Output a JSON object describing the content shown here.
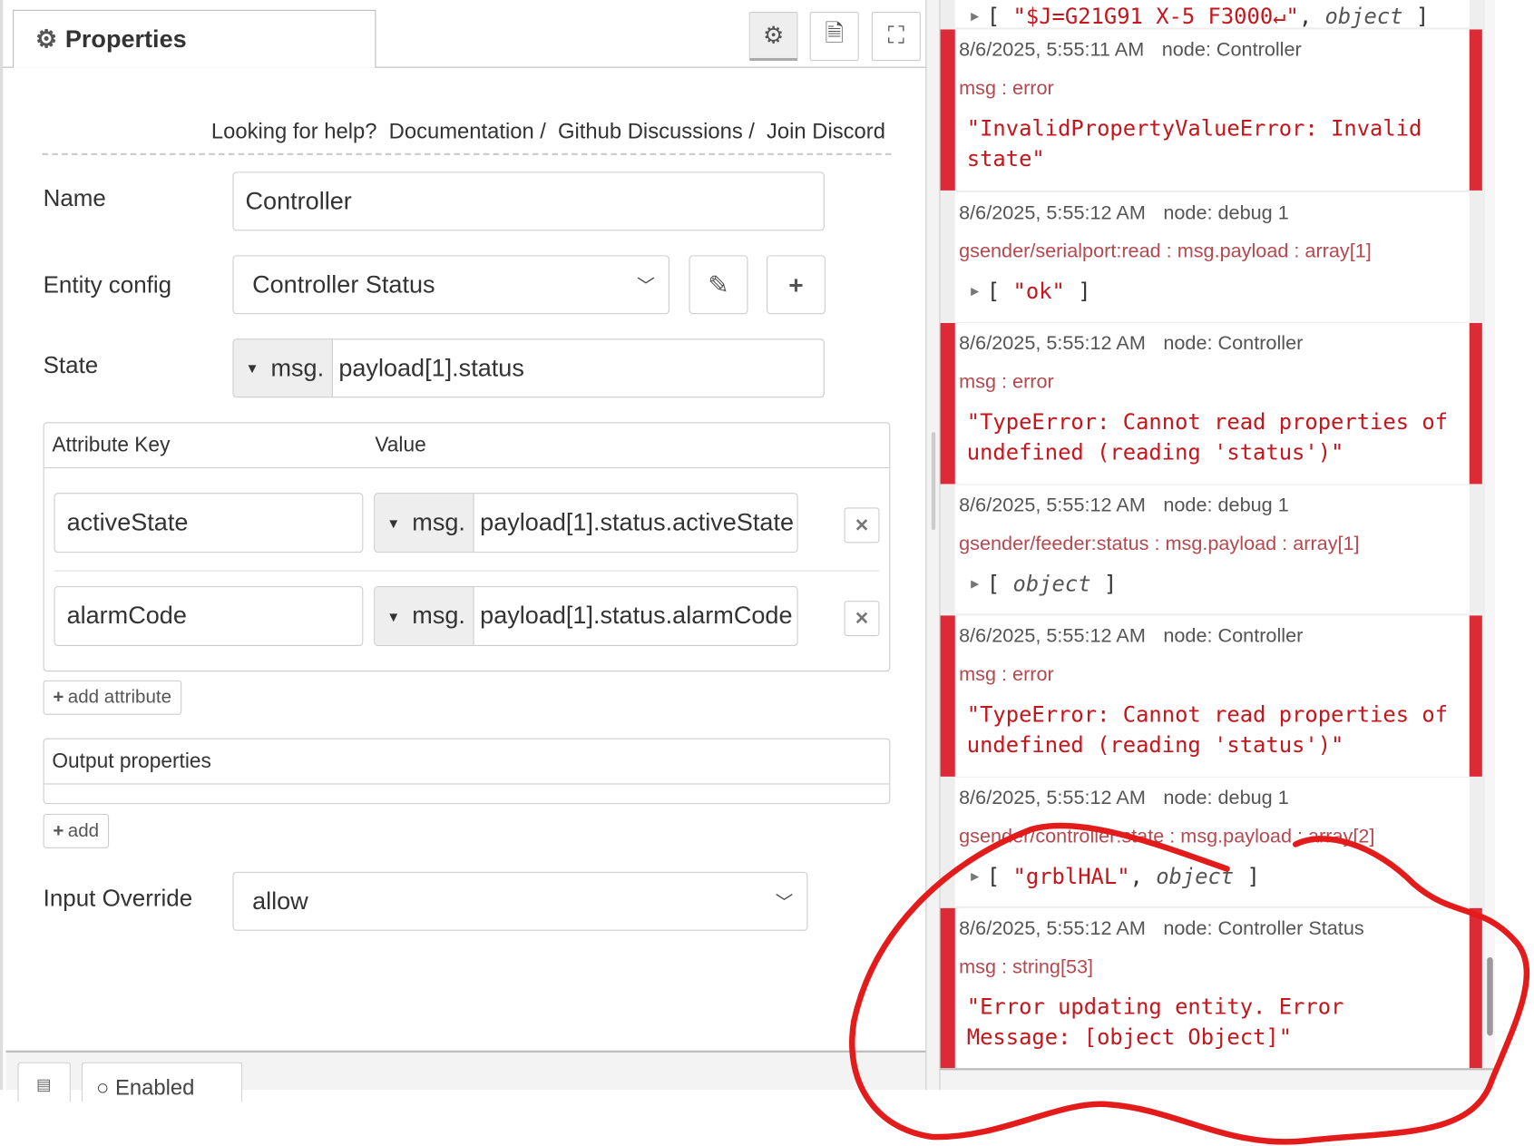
{
  "tab": {
    "label": "Properties"
  },
  "toolbar": {
    "icons": [
      "gear-icon",
      "document-icon",
      "frame-icon"
    ]
  },
  "help": {
    "prefix": "Looking for help?",
    "links": [
      "Documentation",
      "Github Discussions",
      "Join Discord"
    ],
    "sep": "/"
  },
  "form": {
    "name_label": "Name",
    "name_value": "Controller",
    "entity_label": "Entity config",
    "entity_value": "Controller Status",
    "state_label": "State",
    "state_prefix": "msg.",
    "state_value": "payload[1].status",
    "attr_header_key": "Attribute Key",
    "attr_header_value": "Value",
    "attributes": [
      {
        "key": "activeState",
        "prefix": "msg.",
        "value": "payload[1].status.activeState"
      },
      {
        "key": "alarmCode",
        "prefix": "msg.",
        "value": "payload[1].status.alarmCode"
      }
    ],
    "add_attribute": "add attribute",
    "output_label": "Output properties",
    "add": "add",
    "override_label": "Input Override",
    "override_value": "allow"
  },
  "footer": {
    "enabled": "Enabled"
  },
  "debug": {
    "top_partial": {
      "string": "\"$J=G21G91 X-5 F3000↵\"",
      "obj": "object"
    },
    "messages": [
      {
        "type": "error",
        "time": "8/6/2025, 5:55:11 AM",
        "node": "node: Controller",
        "path": "msg : error",
        "body": "\"InvalidPropertyValueError: Invalid state\""
      },
      {
        "type": "debug",
        "time": "8/6/2025, 5:55:12 AM",
        "node": "node: debug 1",
        "path": "gsender/serialport:read : msg.payload : array[1]",
        "arr_str": "\"ok\""
      },
      {
        "type": "error",
        "time": "8/6/2025, 5:55:12 AM",
        "node": "node: Controller",
        "path": "msg : error",
        "body": "\"TypeError: Cannot read properties of undefined (reading 'status')\""
      },
      {
        "type": "debug",
        "time": "8/6/2025, 5:55:12 AM",
        "node": "node: debug 1",
        "path": "gsender/feeder:status : msg.payload : array[1]",
        "arr_obj": "object"
      },
      {
        "type": "error",
        "time": "8/6/2025, 5:55:12 AM",
        "node": "node: Controller",
        "path": "msg : error",
        "body": "\"TypeError: Cannot read properties of undefined (reading 'status')\""
      },
      {
        "type": "debug",
        "time": "8/6/2025, 5:55:12 AM",
        "node": "node: debug 1",
        "path": "gsender/controller:state : msg.payload : array[2]",
        "arr_str": "\"grblHAL\"",
        "arr_obj": "object"
      },
      {
        "type": "error",
        "time": "8/6/2025, 5:55:12 AM",
        "node": "node: Controller Status",
        "path": "msg : string[53]",
        "body": "\"Error updating entity. Error Message: [object Object]\""
      }
    ]
  },
  "colors": {
    "error": "#dc2a37",
    "annotation": "#e41b1b"
  }
}
